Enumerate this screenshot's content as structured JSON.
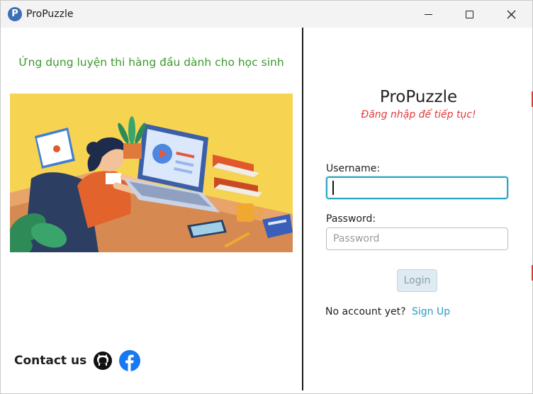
{
  "window": {
    "title": "ProPuzzle",
    "app_icon_letter": "P"
  },
  "left": {
    "tagline": "Ứng dụng luyện thi hàng đầu dành cho học sinh",
    "contact_label": "Contact us",
    "social": [
      "github-icon",
      "facebook-icon"
    ]
  },
  "login": {
    "app_title": "ProPuzzle",
    "subtitle": "Đăng nhập để tiếp tục!",
    "username_label": "Username:",
    "username_value": "",
    "password_label": "Password:",
    "password_placeholder": "Password",
    "login_button": "Login",
    "no_account_text": "No account yet?",
    "signup_link": "Sign Up"
  },
  "colors": {
    "tagline": "#3a9a2b",
    "subtitle": "#e03a3a",
    "accent": "#2aa7c4",
    "link": "#2a9bc0",
    "facebook": "#1877f2",
    "illustration_bg": "#f6d452"
  }
}
